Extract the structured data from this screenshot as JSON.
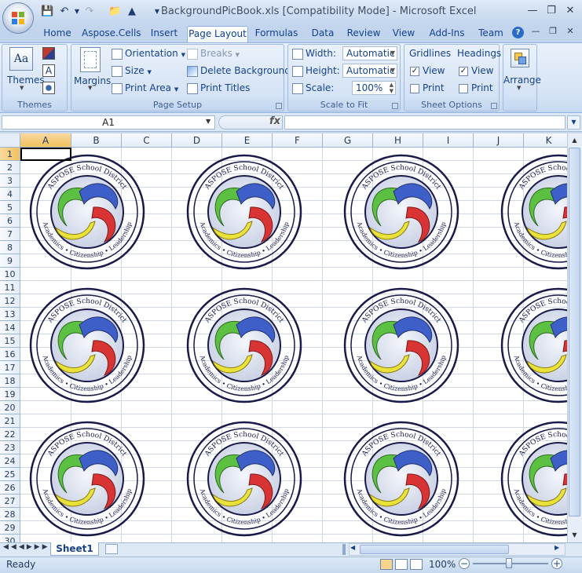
{
  "window": {
    "title": "BackgroundPicBook.xls  [Compatibility Mode] - Microsoft Excel"
  },
  "ribbon_tabs": [
    "Home",
    "Aspose.Cells",
    "Insert",
    "Page Layout",
    "Formulas",
    "Data",
    "Review",
    "View",
    "Add-Ins",
    "Team"
  ],
  "active_tab": "Page Layout",
  "groups": {
    "themes": {
      "label": "Themes",
      "themes_btn": "Themes"
    },
    "page_setup": {
      "label": "Page Setup",
      "margins": "Margins",
      "orientation": "Orientation",
      "size": "Size",
      "print_area": "Print Area",
      "breaks": "Breaks",
      "delete_background": "Delete Background",
      "print_titles": "Print Titles"
    },
    "scale_to_fit": {
      "label": "Scale to Fit",
      "width_label": "Width:",
      "width_value": "Automatic",
      "height_label": "Height:",
      "height_value": "Automatic",
      "scale_label": "Scale:",
      "scale_value": "100%"
    },
    "sheet_options": {
      "label": "Sheet Options",
      "gridlines": "Gridlines",
      "headings": "Headings",
      "view": "View",
      "print": "Print",
      "gridlines_view_checked": true,
      "gridlines_print_checked": false,
      "headings_view_checked": true,
      "headings_print_checked": false
    },
    "arrange": {
      "label": "Arrange"
    }
  },
  "formula_bar": {
    "name_box": "A1",
    "fx": "fx",
    "formula": ""
  },
  "grid": {
    "columns": [
      "A",
      "B",
      "C",
      "D",
      "E",
      "F",
      "G",
      "H",
      "I",
      "J",
      "K"
    ],
    "rows": [
      "1",
      "2",
      "3",
      "4",
      "5",
      "6",
      "7",
      "8",
      "9",
      "10",
      "11",
      "12",
      "13",
      "14",
      "15",
      "16",
      "17",
      "18",
      "19",
      "20",
      "21",
      "22",
      "23",
      "24",
      "25",
      "26",
      "27",
      "28",
      "29",
      "30"
    ],
    "selected_cell": "A1"
  },
  "logo": {
    "top_text": "ASPOSE School District",
    "bottom_text": "Academics • Citizenship • Leadership"
  },
  "sheet_tabs": [
    "Sheet1"
  ],
  "status": {
    "ready": "Ready",
    "zoom": "100%"
  },
  "colors": {
    "ribbon_bg": "#dbe7f6",
    "selection": "#f1c15f",
    "green": "#5cc043",
    "blue": "#3f5fc8",
    "red": "#d93434",
    "yellow": "#e8e23a"
  }
}
